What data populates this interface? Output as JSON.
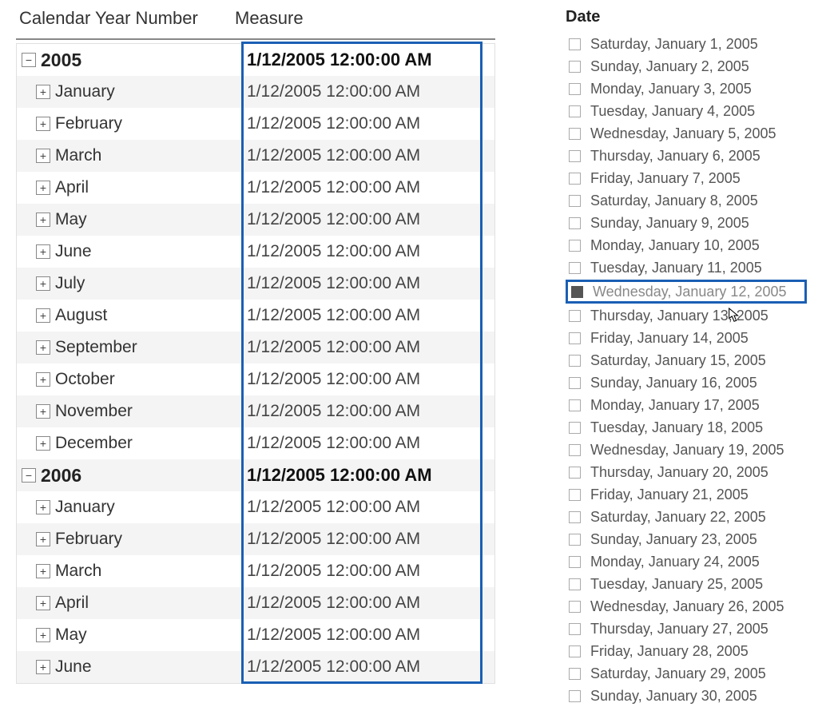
{
  "headers": {
    "col1": "Calendar Year Number",
    "col2": "Measure"
  },
  "rows": [
    {
      "type": "year",
      "label": "2005",
      "measure": "1/12/2005 12:00:00 AM",
      "bold": true,
      "shaded": false,
      "exp": "minus"
    },
    {
      "type": "month",
      "label": "January",
      "measure": "1/12/2005 12:00:00 AM",
      "bold": false,
      "shaded": true,
      "exp": "plus"
    },
    {
      "type": "month",
      "label": "February",
      "measure": "1/12/2005 12:00:00 AM",
      "bold": false,
      "shaded": false,
      "exp": "plus"
    },
    {
      "type": "month",
      "label": "March",
      "measure": "1/12/2005 12:00:00 AM",
      "bold": false,
      "shaded": true,
      "exp": "plus"
    },
    {
      "type": "month",
      "label": "April",
      "measure": "1/12/2005 12:00:00 AM",
      "bold": false,
      "shaded": false,
      "exp": "plus"
    },
    {
      "type": "month",
      "label": "May",
      "measure": "1/12/2005 12:00:00 AM",
      "bold": false,
      "shaded": true,
      "exp": "plus"
    },
    {
      "type": "month",
      "label": "June",
      "measure": "1/12/2005 12:00:00 AM",
      "bold": false,
      "shaded": false,
      "exp": "plus"
    },
    {
      "type": "month",
      "label": "July",
      "measure": "1/12/2005 12:00:00 AM",
      "bold": false,
      "shaded": true,
      "exp": "plus"
    },
    {
      "type": "month",
      "label": "August",
      "measure": "1/12/2005 12:00:00 AM",
      "bold": false,
      "shaded": false,
      "exp": "plus"
    },
    {
      "type": "month",
      "label": "September",
      "measure": "1/12/2005 12:00:00 AM",
      "bold": false,
      "shaded": true,
      "exp": "plus"
    },
    {
      "type": "month",
      "label": "October",
      "measure": "1/12/2005 12:00:00 AM",
      "bold": false,
      "shaded": false,
      "exp": "plus"
    },
    {
      "type": "month",
      "label": "November",
      "measure": "1/12/2005 12:00:00 AM",
      "bold": false,
      "shaded": true,
      "exp": "plus"
    },
    {
      "type": "month",
      "label": "December",
      "measure": "1/12/2005 12:00:00 AM",
      "bold": false,
      "shaded": false,
      "exp": "plus"
    },
    {
      "type": "year",
      "label": "2006",
      "measure": "1/12/2005 12:00:00 AM",
      "bold": true,
      "shaded": true,
      "exp": "minus"
    },
    {
      "type": "month",
      "label": "January",
      "measure": "1/12/2005 12:00:00 AM",
      "bold": false,
      "shaded": false,
      "exp": "plus"
    },
    {
      "type": "month",
      "label": "February",
      "measure": "1/12/2005 12:00:00 AM",
      "bold": false,
      "shaded": true,
      "exp": "plus"
    },
    {
      "type": "month",
      "label": "March",
      "measure": "1/12/2005 12:00:00 AM",
      "bold": false,
      "shaded": false,
      "exp": "plus"
    },
    {
      "type": "month",
      "label": "April",
      "measure": "1/12/2005 12:00:00 AM",
      "bold": false,
      "shaded": true,
      "exp": "plus"
    },
    {
      "type": "month",
      "label": "May",
      "measure": "1/12/2005 12:00:00 AM",
      "bold": false,
      "shaded": false,
      "exp": "plus"
    },
    {
      "type": "month",
      "label": "June",
      "measure": "1/12/2005 12:00:00 AM",
      "bold": false,
      "shaded": true,
      "exp": "plus"
    }
  ],
  "slicer": {
    "title": "Date",
    "items": [
      {
        "label": "Saturday, January 1, 2005",
        "selected": false
      },
      {
        "label": "Sunday, January 2, 2005",
        "selected": false
      },
      {
        "label": "Monday, January 3, 2005",
        "selected": false
      },
      {
        "label": "Tuesday, January 4, 2005",
        "selected": false
      },
      {
        "label": "Wednesday, January 5, 2005",
        "selected": false
      },
      {
        "label": "Thursday, January 6, 2005",
        "selected": false
      },
      {
        "label": "Friday, January 7, 2005",
        "selected": false
      },
      {
        "label": "Saturday, January 8, 2005",
        "selected": false
      },
      {
        "label": "Sunday, January 9, 2005",
        "selected": false
      },
      {
        "label": "Monday, January 10, 2005",
        "selected": false
      },
      {
        "label": "Tuesday, January 11, 2005",
        "selected": false
      },
      {
        "label": "Wednesday, January 12, 2005",
        "selected": true
      },
      {
        "label": "Thursday, January 13, 2005",
        "selected": false
      },
      {
        "label": "Friday, January 14, 2005",
        "selected": false
      },
      {
        "label": "Saturday, January 15, 2005",
        "selected": false
      },
      {
        "label": "Sunday, January 16, 2005",
        "selected": false
      },
      {
        "label": "Monday, January 17, 2005",
        "selected": false
      },
      {
        "label": "Tuesday, January 18, 2005",
        "selected": false
      },
      {
        "label": "Wednesday, January 19, 2005",
        "selected": false
      },
      {
        "label": "Thursday, January 20, 2005",
        "selected": false
      },
      {
        "label": "Friday, January 21, 2005",
        "selected": false
      },
      {
        "label": "Saturday, January 22, 2005",
        "selected": false
      },
      {
        "label": "Sunday, January 23, 2005",
        "selected": false
      },
      {
        "label": "Monday, January 24, 2005",
        "selected": false
      },
      {
        "label": "Tuesday, January 25, 2005",
        "selected": false
      },
      {
        "label": "Wednesday, January 26, 2005",
        "selected": false
      },
      {
        "label": "Thursday, January 27, 2005",
        "selected": false
      },
      {
        "label": "Friday, January 28, 2005",
        "selected": false
      },
      {
        "label": "Saturday, January 29, 2005",
        "selected": false
      },
      {
        "label": "Sunday, January 30, 2005",
        "selected": false
      }
    ]
  }
}
